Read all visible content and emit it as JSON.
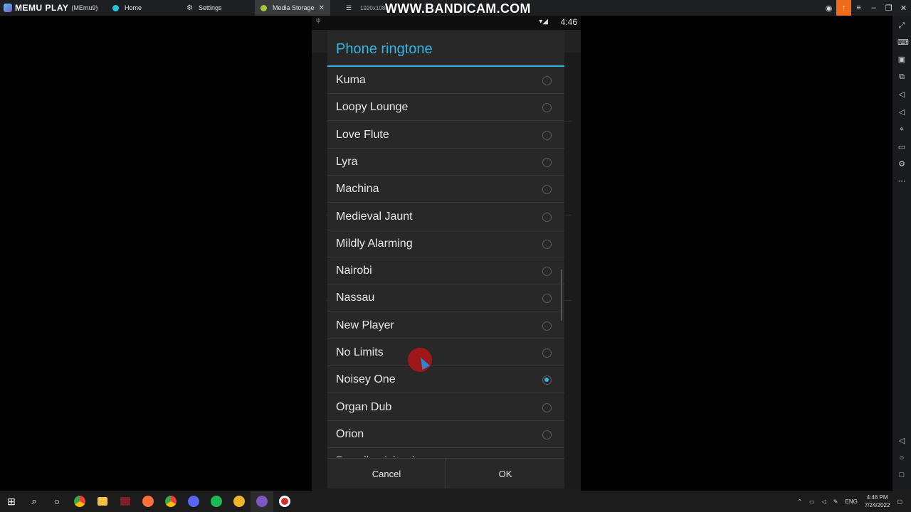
{
  "window": {
    "brand": "MEMU PLAY",
    "instance": "(MEmu9)",
    "tabs": [
      {
        "label": "Home",
        "icon": "home-icon"
      },
      {
        "label": "Settings",
        "icon": "gear-icon"
      },
      {
        "label": "Media Storage",
        "icon": "android-icon",
        "active": true
      }
    ],
    "watermark": "WWW.BANDICAM.COM",
    "recording_resolution": "1920x1080"
  },
  "statusbar": {
    "time": "4:46"
  },
  "dialog": {
    "title": "Phone ringtone",
    "items": [
      {
        "label": "Kuma",
        "selected": false
      },
      {
        "label": "Loopy Lounge",
        "selected": false
      },
      {
        "label": "Love Flute",
        "selected": false
      },
      {
        "label": "Lyra",
        "selected": false
      },
      {
        "label": "Machina",
        "selected": false
      },
      {
        "label": "Medieval Jaunt",
        "selected": false
      },
      {
        "label": "Mildly Alarming",
        "selected": false
      },
      {
        "label": "Nairobi",
        "selected": false
      },
      {
        "label": "Nassau",
        "selected": false
      },
      {
        "label": "New Player",
        "selected": false
      },
      {
        "label": "No Limits",
        "selected": false
      },
      {
        "label": "Noisey One",
        "selected": true
      },
      {
        "label": "Organ Dub",
        "selected": false
      },
      {
        "label": "Orion",
        "selected": false
      },
      {
        "label": "Paradise Island",
        "selected": false
      }
    ],
    "cancel_label": "Cancel",
    "ok_label": "OK"
  },
  "taskbar": {
    "language": "ENG",
    "time": "4:46 PM",
    "date": "7/24/2022"
  },
  "colors": {
    "accent": "#33b5e5",
    "dialog_bg": "#282828",
    "orange": "#f26a1b"
  }
}
